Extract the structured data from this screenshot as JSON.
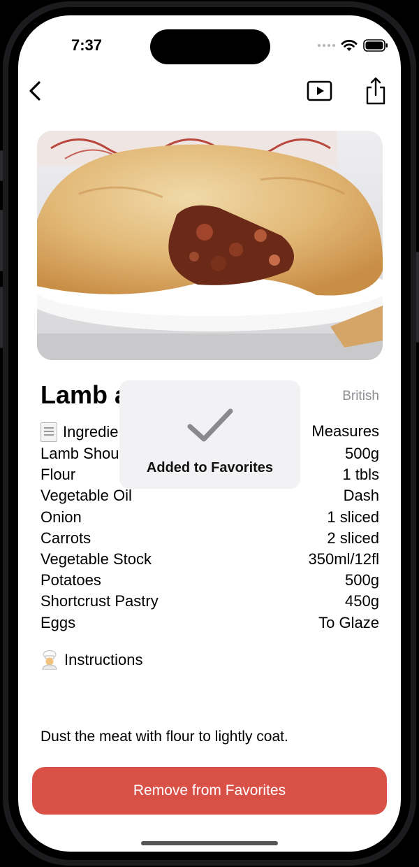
{
  "status_bar": {
    "time": "7:37"
  },
  "nav": {
    "back_icon": "chevron-left-icon",
    "play_icon": "play-rectangle-icon",
    "share_icon": "share-icon"
  },
  "recipe": {
    "title_visible": "Lamb a",
    "cuisine": "British",
    "hero_image": "meat-pie-photo"
  },
  "ingredients": {
    "header_left": "Ingredie",
    "header_right": "Measures",
    "items": [
      {
        "name": "Lamb Shou",
        "measure": "500g"
      },
      {
        "name": "Flour",
        "measure": "1 tbls"
      },
      {
        "name": "Vegetable Oil",
        "measure": "Dash"
      },
      {
        "name": "Onion",
        "measure": "1 sliced"
      },
      {
        "name": "Carrots",
        "measure": "2 sliced"
      },
      {
        "name": "Vegetable Stock",
        "measure": "350ml/12fl"
      },
      {
        "name": "Potatoes",
        "measure": "500g"
      },
      {
        "name": "Shortcrust Pastry",
        "measure": "450g"
      },
      {
        "name": "Eggs",
        "measure": "To Glaze"
      }
    ]
  },
  "instructions": {
    "header": "Instructions",
    "text": "Dust the meat with flour to lightly coat."
  },
  "actions": {
    "remove_favorites": "Remove from Favorites"
  },
  "toast": {
    "message": "Added to Favorites"
  },
  "colors": {
    "remove_button": "#d95047",
    "secondary_text": "#8e8e93",
    "toast_bg": "#f2f2f4"
  }
}
